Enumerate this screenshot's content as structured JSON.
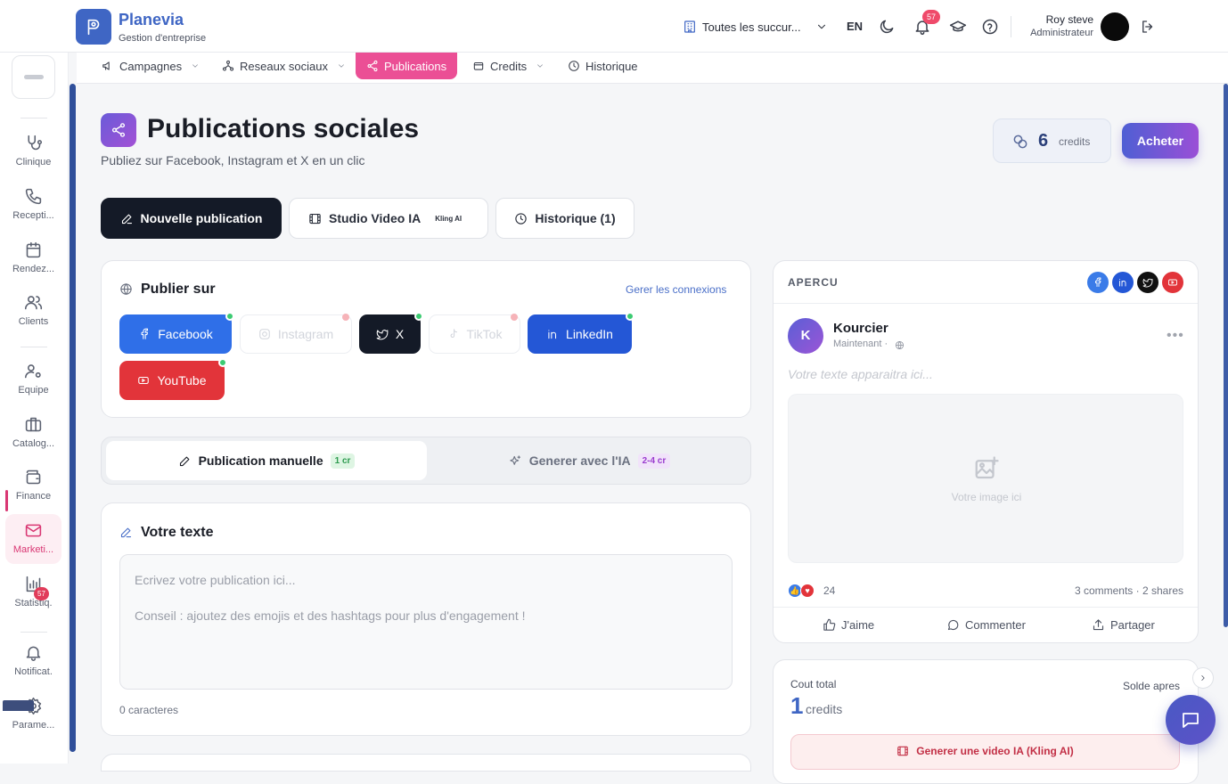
{
  "header": {
    "brand": "Planevia",
    "brand_sub": "Gestion d'entreprise",
    "branch": "Toutes les succur...",
    "lang": "EN",
    "notifications": "57",
    "user_name": "Roy steve",
    "user_role": "Administrateur"
  },
  "sidebar": {
    "items": [
      {
        "label": "Clinique",
        "icon": "stethoscope-icon"
      },
      {
        "label": "Recepti...",
        "icon": "phone-icon"
      },
      {
        "label": "Rendez...",
        "icon": "calendar-icon"
      },
      {
        "label": "Clients",
        "icon": "users-icon"
      },
      {
        "label": "Equipe",
        "icon": "user-cog-icon"
      },
      {
        "label": "Catalog...",
        "icon": "briefcase-icon"
      },
      {
        "label": "Finance",
        "icon": "wallet-icon"
      },
      {
        "label": "Marketi...",
        "icon": "mail-icon"
      },
      {
        "label": "Statistiq.",
        "icon": "bar-chart-icon"
      },
      {
        "label": "Notificat.",
        "icon": "bell-icon"
      },
      {
        "label": "Parame...",
        "icon": "gear-icon"
      }
    ],
    "notif_badge": "57",
    "active": "Marketi..."
  },
  "subnav": {
    "campagnes": "Campagnes",
    "reseaux": "Reseaux sociaux",
    "publications": "Publications",
    "credits": "Credits",
    "historique": "Historique"
  },
  "page": {
    "title": "Publications sociales",
    "subtitle": "Publiez sur Facebook, Instagram et X en un clic",
    "credits_value": "6",
    "credits_label": "credits",
    "buy": "Acheter"
  },
  "tabs": {
    "new": "Nouvelle publication",
    "studio": "Studio Video IA",
    "kling": "Kling AI",
    "history": "Historique (1)"
  },
  "publish": {
    "title": "Publier sur",
    "manage": "Gerer les connexions",
    "networks": [
      {
        "label": "Facebook",
        "connected": true,
        "color": "#2f6fe8"
      },
      {
        "label": "Instagram",
        "connected": false
      },
      {
        "label": "X",
        "connected": true,
        "color": "#141a27"
      },
      {
        "label": "TikTok",
        "connected": false
      },
      {
        "label": "LinkedIn",
        "connected": true,
        "color": "#2457d6"
      },
      {
        "label": "YouTube",
        "connected": true,
        "color": "#e2343a"
      }
    ]
  },
  "mode": {
    "manual": "Publication manuelle",
    "manual_cost": "1 cr",
    "ai": "Generer avec l'IA",
    "ai_cost": "2-4 cr"
  },
  "text": {
    "title": "Votre texte",
    "placeholder": "Ecrivez votre publication ici...\n\nConseil : ajoutez des emojis et des hashtags pour plus d'engagement !",
    "count": "0 caracteres"
  },
  "preview": {
    "label": "APERCU",
    "account": "Kourcier",
    "initial": "K",
    "time": "Maintenant ·",
    "text": "Votre texte apparaitra ici...",
    "image": "Votre image ici",
    "reactions": "24",
    "stats": "3 comments · 2 shares",
    "like": "J'aime",
    "comment": "Commenter",
    "share": "Partager"
  },
  "cost": {
    "label": "Cout total",
    "value": "1",
    "unit": "credits",
    "solde": "Solde apres",
    "video_button": "Generer une video IA (Kling AI)"
  }
}
